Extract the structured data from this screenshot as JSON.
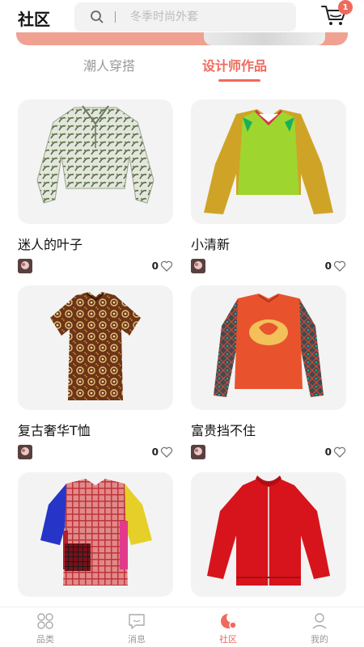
{
  "header": {
    "title": "社区",
    "search_placeholder": "冬季时尚外套",
    "cart_badge": "1"
  },
  "tabs": [
    {
      "label": "潮人穿搭",
      "active": false
    },
    {
      "label": "设计师作品",
      "active": true
    }
  ],
  "colors": {
    "accent": "#ef6a5d",
    "inactive_text": "#999999",
    "card_bg": "#f3f3f3"
  },
  "products": [
    {
      "name": "迷人的叶子",
      "likes": "0",
      "image_icon": "floral-hoodie-icon"
    },
    {
      "name": "小清新",
      "likes": "0",
      "image_icon": "green-yellow-blouse-icon"
    },
    {
      "name": "复古奢华T恤",
      "likes": "0",
      "image_icon": "patterned-tshirt-icon"
    },
    {
      "name": "富贵挡不住",
      "likes": "0",
      "image_icon": "orange-longsleeve-icon"
    },
    {
      "name": "",
      "likes": "",
      "image_icon": "plaid-colorblock-top-icon"
    },
    {
      "name": "",
      "likes": "",
      "image_icon": "red-zip-jacket-icon"
    }
  ],
  "tabbar": [
    {
      "label": "品类",
      "icon": "grid-icon",
      "active": false
    },
    {
      "label": "消息",
      "icon": "chat-icon",
      "active": false
    },
    {
      "label": "社区",
      "icon": "community-icon",
      "active": true
    },
    {
      "label": "我的",
      "icon": "user-icon",
      "active": false
    }
  ]
}
